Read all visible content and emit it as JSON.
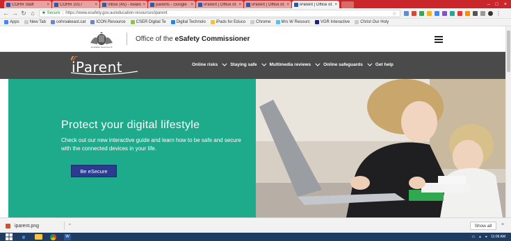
{
  "browser": {
    "tabs": [
      {
        "label": "COHR Staff"
      },
      {
        "label": "COHR 2017"
      },
      {
        "label": "Inbox (45) - kwalsh"
      },
      {
        "label": "parents - Google"
      },
      {
        "label": "iParent | Office of..."
      },
      {
        "label": "iParent | Office of..."
      },
      {
        "label": "iParent | Office of..."
      }
    ],
    "active_tab_index": 6,
    "address": {
      "secure_label": "Secure",
      "url": "https://www.esafety.gov.au/education-resources/iparent"
    },
    "bookmarks": [
      {
        "label": "Apps"
      },
      {
        "label": "New Tab"
      },
      {
        "label": "cohroakeast.cat"
      },
      {
        "label": "ICON Resource"
      },
      {
        "label": "CSER Digital Te"
      },
      {
        "label": "Digital Technolo"
      },
      {
        "label": "iPads for Educo"
      },
      {
        "label": "Chrome"
      },
      {
        "label": "Mrs W Resourc"
      },
      {
        "label": "VGR Interactive"
      },
      {
        "label": "Christ Our Holy"
      }
    ]
  },
  "site": {
    "crest_text": "Australian Government",
    "org_prefix": "Office of the ",
    "org_bold": "eSafety Commissioner",
    "logo_text": "iParent",
    "nav": [
      {
        "label": "Online risks"
      },
      {
        "label": "Staying safe"
      },
      {
        "label": "Multimedia reviews"
      },
      {
        "label": "Online safeguards"
      },
      {
        "label": "Get help"
      }
    ]
  },
  "hero": {
    "title": "Protect your digital lifestyle",
    "body": "Check out our new interactive guide and learn how to be safe and secure with the connected devices in your life.",
    "cta": "Be eSecure"
  },
  "downloads": {
    "file": "iparent.png",
    "show_all": "Show all"
  },
  "taskbar": {
    "time": "11:06 AM"
  }
}
